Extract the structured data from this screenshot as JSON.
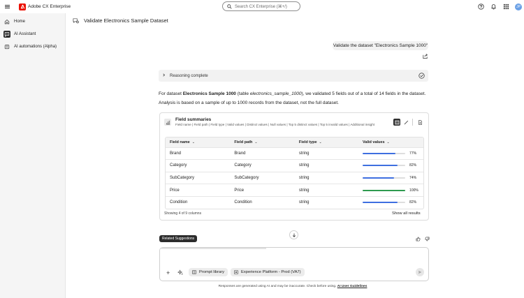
{
  "topbar": {
    "app_name": "Adobe CX Enterprise",
    "search_placeholder": "Search CX Enterprise (⌘+/)",
    "avatar_initials": "JP",
    "brand_color": "#eb1000"
  },
  "sidebar": {
    "items": [
      {
        "label": "Home",
        "icon": "home-icon",
        "active": false
      },
      {
        "label": "AI Assistant",
        "icon": "ai-assistant-icon",
        "active": true
      },
      {
        "label": "AI automations (Alpha)",
        "icon": "ai-automations-icon",
        "active": false
      }
    ]
  },
  "page": {
    "title": "Validate Electronics Sample Dataset"
  },
  "conversation": {
    "user_message": "Validate the dataset \"Electronics Sample 1000\"",
    "reasoning_label": "Reasoning complete",
    "summary": {
      "part1": "For dataset ",
      "dataset_name": "Electronics Sample 1000",
      "part2": " (table ",
      "table_name": "electronics_sample_1000",
      "part3": "), we validated 5 fields out of a total of 14 fields in the dataset.",
      "line2": "Analysis is based on a sample of up to 1000 records from the dataset, not the full dataset."
    }
  },
  "card": {
    "title": "Field summaries",
    "subtitle": "Field name | Field path | Field type | Valid values | Distinct values | Null values | Top 5 distinct values | Top 5 invalid values | Additional insight",
    "columns": [
      "Field name",
      "Field path",
      "Field type",
      "Valid values"
    ],
    "rows": [
      {
        "name": "Brand",
        "path": "Brand",
        "type": "string",
        "valid": "77%",
        "valid_value": 77,
        "bar_color": "#3e6fe0"
      },
      {
        "name": "Category",
        "path": "Category",
        "type": "string",
        "valid": "82%",
        "valid_value": 82,
        "bar_color": "#3e6fe0"
      },
      {
        "name": "SubCategory",
        "path": "SubCategory",
        "type": "string",
        "valid": "74%",
        "valid_value": 74,
        "bar_color": "#3e6fe0"
      },
      {
        "name": "Price",
        "path": "Price",
        "type": "string",
        "valid": "100%",
        "valid_value": 100,
        "bar_color": "#2e9a4f"
      },
      {
        "name": "Condition",
        "path": "Condition",
        "type": "string",
        "valid": "82%",
        "valid_value": 82,
        "bar_color": "#3e6fe0"
      }
    ],
    "showing": "Showing 4 of 9 columns",
    "show_all": "Show all results"
  },
  "related_suggestions": "Related Suggestions",
  "prompt": {
    "prompt_library": "Prompt library",
    "sandbox": "Experience Platform - Prod (VA7)"
  },
  "footer": {
    "text": "Responses are generated using AI and may be inaccurate. Check before using.",
    "link": "AI User Guidelines"
  }
}
